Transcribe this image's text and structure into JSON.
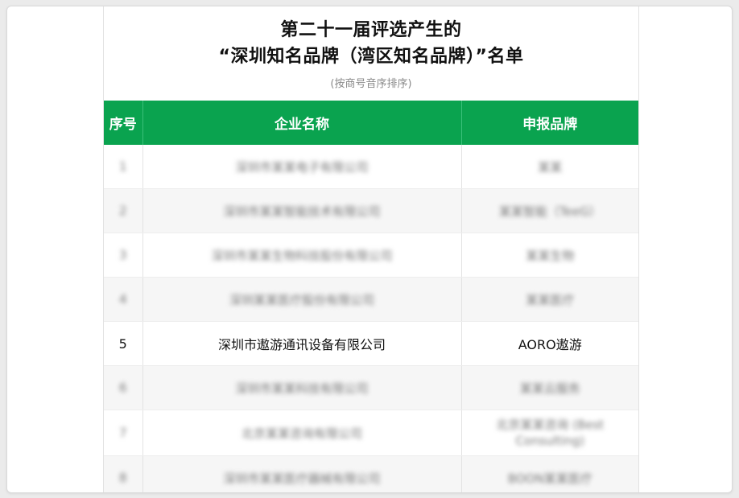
{
  "document": {
    "title_line1": "第二十一届评选产生的",
    "title_line2": "“深圳知名品牌（湾区知名品牌）”名单",
    "subtitle": "(按商号音序排序)"
  },
  "table": {
    "headers": [
      "序号",
      "企业名称",
      "申报品牌"
    ],
    "rows": [
      {
        "no": "1",
        "company": "深圳市某某电子有限公司",
        "brand": "某某"
      },
      {
        "no": "2",
        "company": "深圳市某某智能技术有限公司",
        "brand": "某某智能（TeeG）"
      },
      {
        "no": "3",
        "company": "深圳市某某生物科技股份有限公司",
        "brand": "某某生物"
      },
      {
        "no": "4",
        "company": "深圳某某医疗股份有限公司",
        "brand": "某某医疗"
      },
      {
        "no": "5",
        "company": "深圳市遨游通讯设备有限公司",
        "brand": "AORO遨游"
      },
      {
        "no": "6",
        "company": "深圳市某某科技有限公司",
        "brand": "某某云服务"
      },
      {
        "no": "7",
        "company": "北京某某咨询有限公司",
        "brand": "北京某某咨询 (Best Consulting)"
      },
      {
        "no": "8",
        "company": "深圳市某某医疗器械有限公司",
        "brand": "BOON某某医疗"
      }
    ]
  },
  "colors": {
    "header_green": "#0aa34f",
    "background": "#ebebeb"
  }
}
